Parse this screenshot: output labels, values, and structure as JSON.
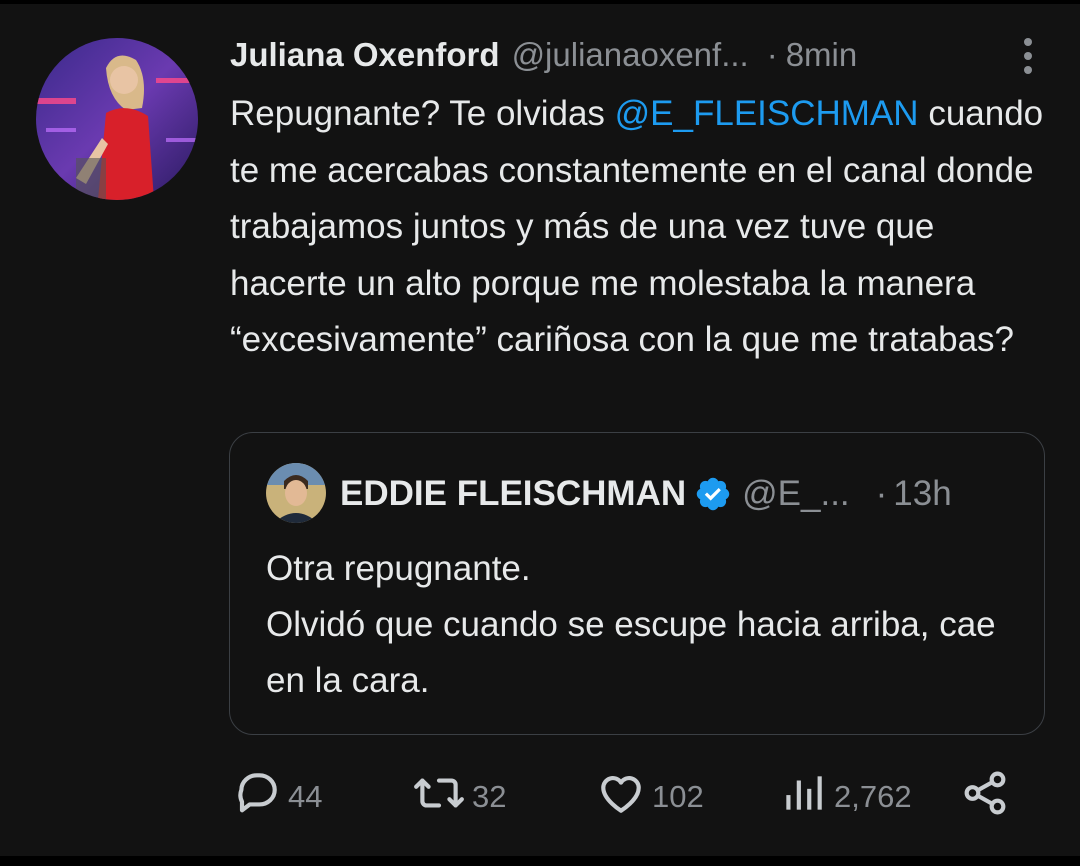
{
  "tweet": {
    "author_name": "Juliana Oxenford",
    "author_handle": "@julianaoxenf...",
    "separator": "·",
    "time": "8min",
    "text_before": "Repugnante? Te olvidas ",
    "mention": "@E_FLEISCHMAN",
    "text_after": " cuando te me acercabas constantemente en el canal donde trabajamos juntos y más de una vez tuve que hacerte un alto porque me molestaba la manera “excesivamente” cariñosa con la que me tratabas?"
  },
  "quoted": {
    "author_name": "EDDIE FLEISCHMAN",
    "author_handle": "@E_...",
    "separator": "·",
    "time": "13h",
    "line1": "Otra repugnante.",
    "line2": "Olvidó que cuando se escupe hacia arriba, cae en la cara."
  },
  "actions": {
    "replies": "44",
    "retweets": "32",
    "likes": "102",
    "views": "2,762"
  },
  "icons": [
    "more-icon",
    "verified-icon",
    "reply-icon",
    "retweet-icon",
    "like-icon",
    "views-icon",
    "share-icon"
  ],
  "colors": {
    "accent": "#1d9bf0",
    "background": "#121212",
    "muted": "#8b8f94"
  }
}
